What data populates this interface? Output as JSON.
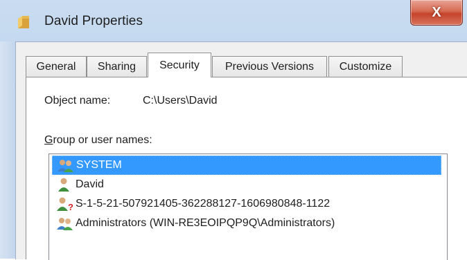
{
  "window": {
    "title": "David Properties",
    "close_glyph": "X",
    "icons": {
      "title": "folder-icon",
      "close": "close-icon"
    }
  },
  "tabs": [
    {
      "label": "General",
      "active": false
    },
    {
      "label": "Sharing",
      "active": false
    },
    {
      "label": "Security",
      "active": true
    },
    {
      "label": "Previous Versions",
      "active": false
    },
    {
      "label": "Customize",
      "active": false
    }
  ],
  "security": {
    "object_name_label": "Object name:",
    "object_name_value": "C:\\Users\\David",
    "group_label_first": "G",
    "group_label_rest": "roup or user names:",
    "entries": [
      {
        "name": "SYSTEM",
        "icon": "user-group-icon",
        "selected": true
      },
      {
        "name": "David",
        "icon": "user-icon",
        "selected": false
      },
      {
        "name": "S-1-5-21-507921405-362288127-1606980848-1122",
        "icon": "unknown-user-icon",
        "selected": false
      },
      {
        "name": "Administrators (WIN-RE3EOIPQP9Q\\Administrators)",
        "icon": "user-group-icon",
        "selected": false
      }
    ]
  },
  "colors": {
    "selection": "#3399ff",
    "frame": "#bcd3ee",
    "close_button": "#c5432b"
  }
}
